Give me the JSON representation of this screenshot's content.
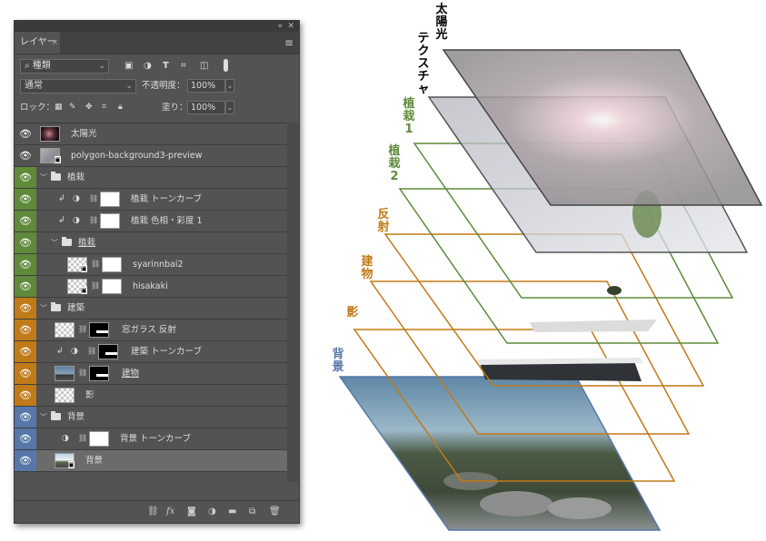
{
  "panel": {
    "topbar": {
      "collapse": "«",
      "close": "✕"
    },
    "tab": {
      "label": "レイヤー",
      "close": "×"
    },
    "menu_icon": "≡",
    "filter": {
      "search_icon": "⌕",
      "kind_label": "種類",
      "chevron": "⌄",
      "icons": [
        "image-filter-icon",
        "adjust-filter-icon",
        "type-filter-icon",
        "shape-filter-icon",
        "smart-filter-icon",
        "filter-toggle-icon"
      ]
    },
    "blend": {
      "mode": "通常",
      "opacity_label": "不透明度：",
      "opacity_value": "100%"
    },
    "lock": {
      "label": "ロック：",
      "fill_label": "塗り：",
      "fill_value": "100%"
    },
    "layers": [
      {
        "name": "太陽光",
        "type": "pixel",
        "color": "none"
      },
      {
        "name": "polygon-background3-preview",
        "type": "smart",
        "color": "none"
      },
      {
        "name": "植栽",
        "type": "group",
        "color": "#5e8a3a",
        "indent": 0
      },
      {
        "name": "植栽 トーンカーブ",
        "type": "adjust",
        "color": "#5e8a3a"
      },
      {
        "name": "植栽 色相・彩度 1",
        "type": "adjust",
        "color": "#5e8a3a"
      },
      {
        "name": "植栽",
        "type": "group",
        "color": "#5e8a3a",
        "indent": 1
      },
      {
        "name": "syarinnbai2",
        "type": "smart-mask",
        "color": "#5e8a3a"
      },
      {
        "name": "hisakaki",
        "type": "smart-mask",
        "color": "#5e8a3a"
      },
      {
        "name": "建築",
        "type": "group",
        "color": "#c07a18",
        "indent": 0
      },
      {
        "name": "窓ガラス 反射",
        "type": "pixel-mask",
        "color": "#c07a18"
      },
      {
        "name": "建築 トーンカーブ",
        "type": "adjust-black",
        "color": "#c07a18"
      },
      {
        "name": "建物",
        "type": "photo-mask",
        "color": "#c07a18"
      },
      {
        "name": "影",
        "type": "pixel",
        "color": "#c07a18"
      },
      {
        "name": "背景",
        "type": "group",
        "color": "#5677a8",
        "indent": 0
      },
      {
        "name": "背景 トーンカーブ",
        "type": "adjust",
        "color": "#5677a8"
      },
      {
        "name": "背景",
        "type": "smart",
        "color": "#5677a8",
        "selected": true
      }
    ],
    "bottom_icons": [
      "link-icon",
      "fx-icon",
      "mask-icon",
      "adjustment-icon",
      "folder-icon",
      "new-layer-icon",
      "trash-icon"
    ],
    "fx_label": "fx"
  },
  "diagram": {
    "labels": [
      {
        "text": "太陽光",
        "color": "#000000"
      },
      {
        "text": "テクスチャ",
        "color": "#000000"
      },
      {
        "text": "植栽1",
        "color": "#5e8a3a"
      },
      {
        "text": "植栽2",
        "color": "#5e8a3a"
      },
      {
        "text": "反射",
        "color": "#c07a18"
      },
      {
        "text": "建物",
        "color": "#c07a18"
      },
      {
        "text": "影",
        "color": "#c07a18"
      },
      {
        "text": "背景",
        "color": "#5677a8"
      }
    ]
  }
}
